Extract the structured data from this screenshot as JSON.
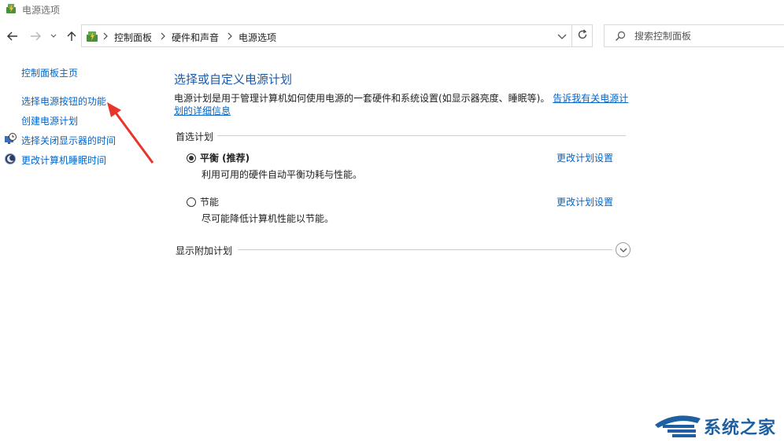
{
  "window": {
    "title": "电源选项",
    "icon": "power-options-icon"
  },
  "navigation": {
    "back_icon": "arrow-left-icon",
    "forward_icon": "arrow-right-icon",
    "recent_icon": "chevron-down-icon",
    "up_icon": "arrow-up-icon"
  },
  "address_bar": {
    "breadcrumbs": [
      "控制面板",
      "硬件和声音",
      "电源选项"
    ],
    "dropdown_icon": "chevron-down-icon",
    "refresh_icon": "refresh-icon"
  },
  "search": {
    "placeholder": "搜索控制面板",
    "icon": "search-icon"
  },
  "sidebar": {
    "home_label": "控制面板主页",
    "items": [
      {
        "label": "选择电源按钮的功能"
      },
      {
        "label": "创建电源计划"
      },
      {
        "label": "选择关闭显示器的时间",
        "icon": "display-clock-icon"
      },
      {
        "label": "更改计算机睡眠时间",
        "icon": "moon-sleep-icon"
      }
    ]
  },
  "main": {
    "title": "选择或自定义电源计划",
    "description": "电源计划是用于管理计算机如何使用电源的一套硬件和系统设置(如显示器亮度、睡眠等)。",
    "description_link": "告诉我有关电源计划的详细信息",
    "preferred_plans_label": "首选计划",
    "plans": [
      {
        "name": "平衡 (推荐)",
        "description": "利用可用的硬件自动平衡功耗与性能。",
        "selected": true,
        "change_label": "更改计划设置"
      },
      {
        "name": "节能",
        "description": "尽可能降低计算机性能以节能。",
        "selected": false,
        "change_label": "更改计划设置"
      }
    ],
    "additional_plans_label": "显示附加计划",
    "expand_icon": "chevron-down-circle-icon"
  },
  "watermark": {
    "text": "系统之家"
  },
  "colors": {
    "link": "#0066cc",
    "title": "#1a5aa8",
    "annotation_arrow": "#e8352b",
    "watermark": "#1d5fa0"
  }
}
